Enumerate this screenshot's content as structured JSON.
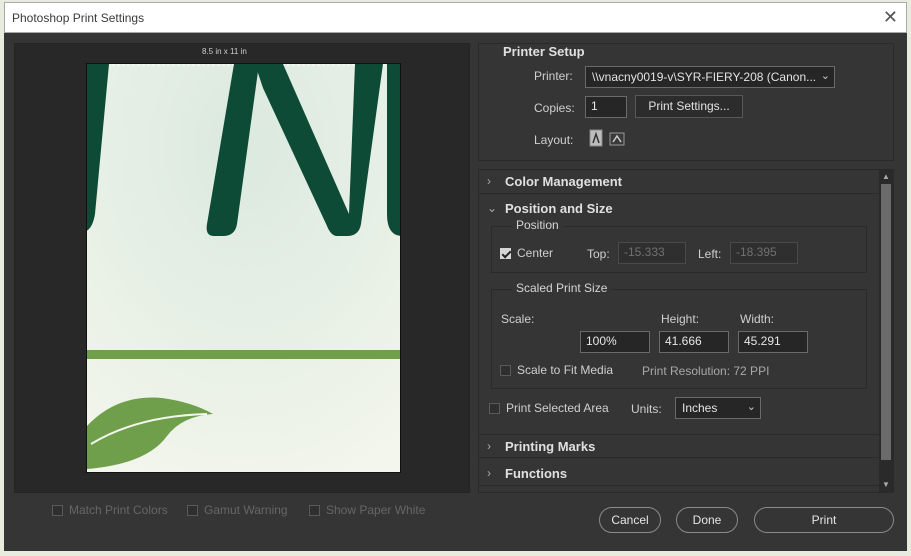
{
  "window": {
    "title": "Photoshop Print Settings"
  },
  "preview": {
    "paper_label": "8.5 in x 11 in",
    "options": [
      {
        "label": "Match Print Colors",
        "checked": false
      },
      {
        "label": "Gamut Warning",
        "checked": false
      },
      {
        "label": "Show Paper White",
        "checked": false
      }
    ]
  },
  "printer_setup": {
    "heading": "Printer Setup",
    "printer_label": "Printer:",
    "printer_value": "\\\\vnacny0019-v\\SYR-FIERY-208 (Canon...",
    "copies_label": "Copies:",
    "copies_value": "1",
    "print_settings_button": "Print Settings...",
    "layout_label": "Layout:",
    "layout_icons": [
      "portrait-layout-icon",
      "landscape-layout-icon"
    ]
  },
  "sections": {
    "color_management": "Color Management",
    "position_and_size": "Position and Size",
    "printing_marks": "Printing Marks",
    "functions": "Functions"
  },
  "position": {
    "group_title": "Position",
    "center_label": "Center",
    "center_checked": true,
    "top_label": "Top:",
    "top_value": "-15.333",
    "left_label": "Left:",
    "left_value": "-18.395"
  },
  "scaled_print_size": {
    "group_title": "Scaled Print Size",
    "scale_label": "Scale:",
    "scale_value": "100%",
    "height_label": "Height:",
    "height_value": "41.666",
    "width_label": "Width:",
    "width_value": "45.291",
    "scale_to_fit_label": "Scale to Fit Media",
    "scale_to_fit_checked": false,
    "print_resolution": "Print Resolution: 72 PPI"
  },
  "print_selected_area": {
    "label": "Print Selected Area",
    "checked": false
  },
  "units": {
    "label": "Units:",
    "value": "Inches"
  },
  "buttons": {
    "cancel": "Cancel",
    "done": "Done",
    "print": "Print"
  },
  "colors": {
    "dialog_bg": "#353535",
    "preview_bg": "#282828",
    "artwork_green_dark": "#0e4b36",
    "artwork_green_light": "#6f9f4a"
  }
}
